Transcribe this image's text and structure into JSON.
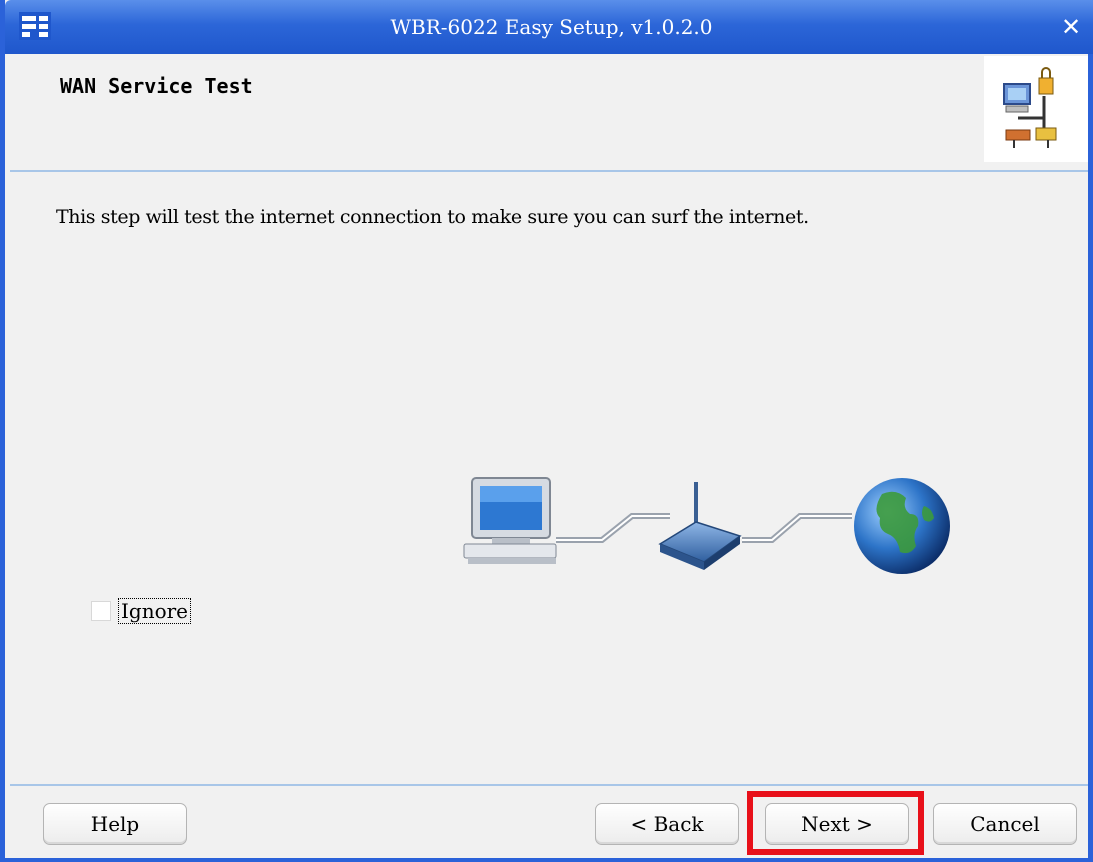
{
  "window": {
    "title": "WBR-6022 Easy Setup, v1.0.2.0",
    "icons": {
      "app": "app-logo-icon",
      "close": "close-icon"
    },
    "colors": {
      "titlebar": "#2c66d8",
      "border": "#2b62d9"
    }
  },
  "header": {
    "title": "WAN Service Test",
    "icon": "network-setup-icon"
  },
  "main": {
    "description": "This step will test the internet connection to make sure you can surf the internet.",
    "illustration": [
      "computer-icon",
      "router-icon",
      "globe-icon"
    ],
    "ignore_checkbox": {
      "label": "Ignore",
      "checked": false
    }
  },
  "footer": {
    "help_label": "Help",
    "back_label": "< Back",
    "next_label": "Next >",
    "cancel_label": "Cancel",
    "highlight_color": "#e8101a"
  }
}
